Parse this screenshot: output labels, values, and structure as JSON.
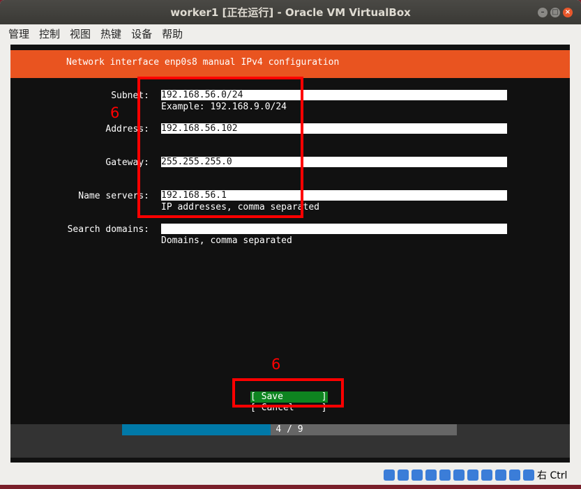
{
  "window": {
    "title": "worker1 [正在运行] - Oracle VM VirtualBox"
  },
  "menu": [
    "管理",
    "控制",
    "视图",
    "热键",
    "设备",
    "帮助"
  ],
  "installer": {
    "header": "Network interface enp0s8 manual IPv4 configuration",
    "fields": [
      {
        "label": "Subnet:",
        "value": "192.168.56.0/24",
        "hint": "Example: 192.168.9.0/24"
      },
      {
        "label": "Address:",
        "value": "192.168.56.102",
        "hint": ""
      },
      {
        "label": "Gateway:",
        "value": "255.255.255.0",
        "hint": ""
      },
      {
        "label": "Name servers:",
        "value": "192.168.56.1",
        "hint": "IP addresses, comma separated"
      },
      {
        "label": "Search domains:",
        "value": "",
        "hint": "Domains, comma separated"
      }
    ],
    "save_label": "[ Save       ]",
    "cancel_label": "[ Cancel     ]",
    "progress_text": "4 / 9",
    "progress_fraction": 0.4444,
    "colors": {
      "header": "#e95420",
      "save": "#0e8420",
      "progress": "#0079a8"
    }
  },
  "annotations": [
    "6",
    "6"
  ],
  "statusbar": {
    "host_key": "右 Ctrl",
    "icons": [
      "hdd-icon",
      "optical-icon",
      "audio-icon",
      "network-icon",
      "usb-icon",
      "shared-folder-icon",
      "display-icon",
      "video-capture-icon",
      "cpu-icon",
      "mouse-integration-icon",
      "keyboard-icon"
    ]
  }
}
